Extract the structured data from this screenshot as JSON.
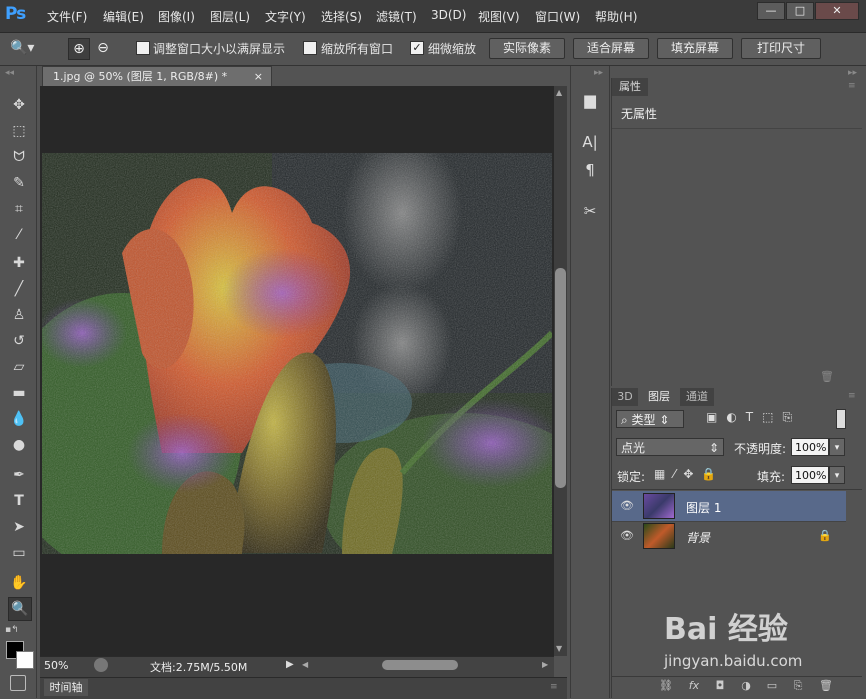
{
  "app": {
    "logo": "Ps"
  },
  "menu": [
    "文件(F)",
    "编辑(E)",
    "图像(I)",
    "图层(L)",
    "文字(Y)",
    "选择(S)",
    "滤镜(T)",
    "3D(D)",
    "视图(V)",
    "窗口(W)",
    "帮助(H)"
  ],
  "window_buttons": {
    "minimize": "—",
    "restore": "□",
    "close": "✕"
  },
  "options_bar": {
    "zoom_in_icon": "⊕",
    "zoom_out_icon": "⊖",
    "resize_windows_label": "调整窗口大小以满屏显示",
    "resize_windows_checked": false,
    "zoom_all_label": "缩放所有窗口",
    "zoom_all_checked": false,
    "scrubby_zoom_label": "细微缩放",
    "scrubby_zoom_checked": true,
    "actual_pixels": "实际像素",
    "fit_screen": "适合屏幕",
    "fill_screen": "填充屏幕",
    "print_size": "打印尺寸"
  },
  "document": {
    "tab_title": "1.jpg @ 50% (图层 1, RGB/8#) *",
    "tab_close": "×",
    "zoom": "50%",
    "doc_info": "文档:2.75M/5.50M"
  },
  "timeline_tab": "时间轴",
  "properties": {
    "tab": "属性",
    "content": "无属性"
  },
  "layers": {
    "tabs": [
      "3D",
      "图层",
      "通道"
    ],
    "active_tab": "图层",
    "filter_kind": "类型",
    "blend_mode": "点光",
    "opacity_label": "不透明度:",
    "opacity": "100%",
    "lock_label": "锁定:",
    "fill_label": "填充:",
    "fill": "100%",
    "items": [
      {
        "name": "图层 1",
        "selected": true,
        "locked": false
      },
      {
        "name": "背景",
        "selected": false,
        "locked": true
      }
    ]
  },
  "watermark": {
    "brand": "Bai 经验",
    "url": "jingyan.baidu.com"
  },
  "colors": {
    "accent": "#3fa0ff",
    "selected_layer": "#58698a",
    "panel": "#535353",
    "canvas_bg": "#282828"
  }
}
